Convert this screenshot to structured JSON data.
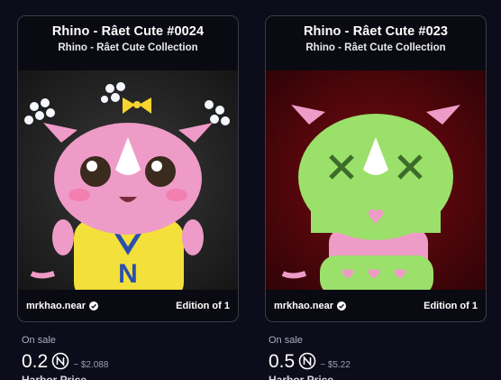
{
  "cards": [
    {
      "title": "Rhino - Râet Cute #0024",
      "collection": "Rhino - Râet Cute Collection",
      "creator": "mrkhao.near",
      "edition": "Edition of 1",
      "sale_status": "On sale",
      "price": "0.2",
      "usd_price": "~ $2.088",
      "cut_text": "Harbor Price"
    },
    {
      "title": "Rhino - Râet Cute #023",
      "collection": "Rhino - Râet Cute Collection",
      "creator": "mrkhao.near",
      "edition": "Edition of 1",
      "sale_status": "On sale",
      "price": "0.5",
      "usd_price": "~ $5.22",
      "cut_text": "Harbor Price"
    }
  ],
  "icons": {
    "verified": "verified-check-icon",
    "currency": "near-currency-icon"
  },
  "colors": {
    "background": "#0c0c1a",
    "card_border": "#3a3a48",
    "muted_text": "#aab0c0"
  }
}
